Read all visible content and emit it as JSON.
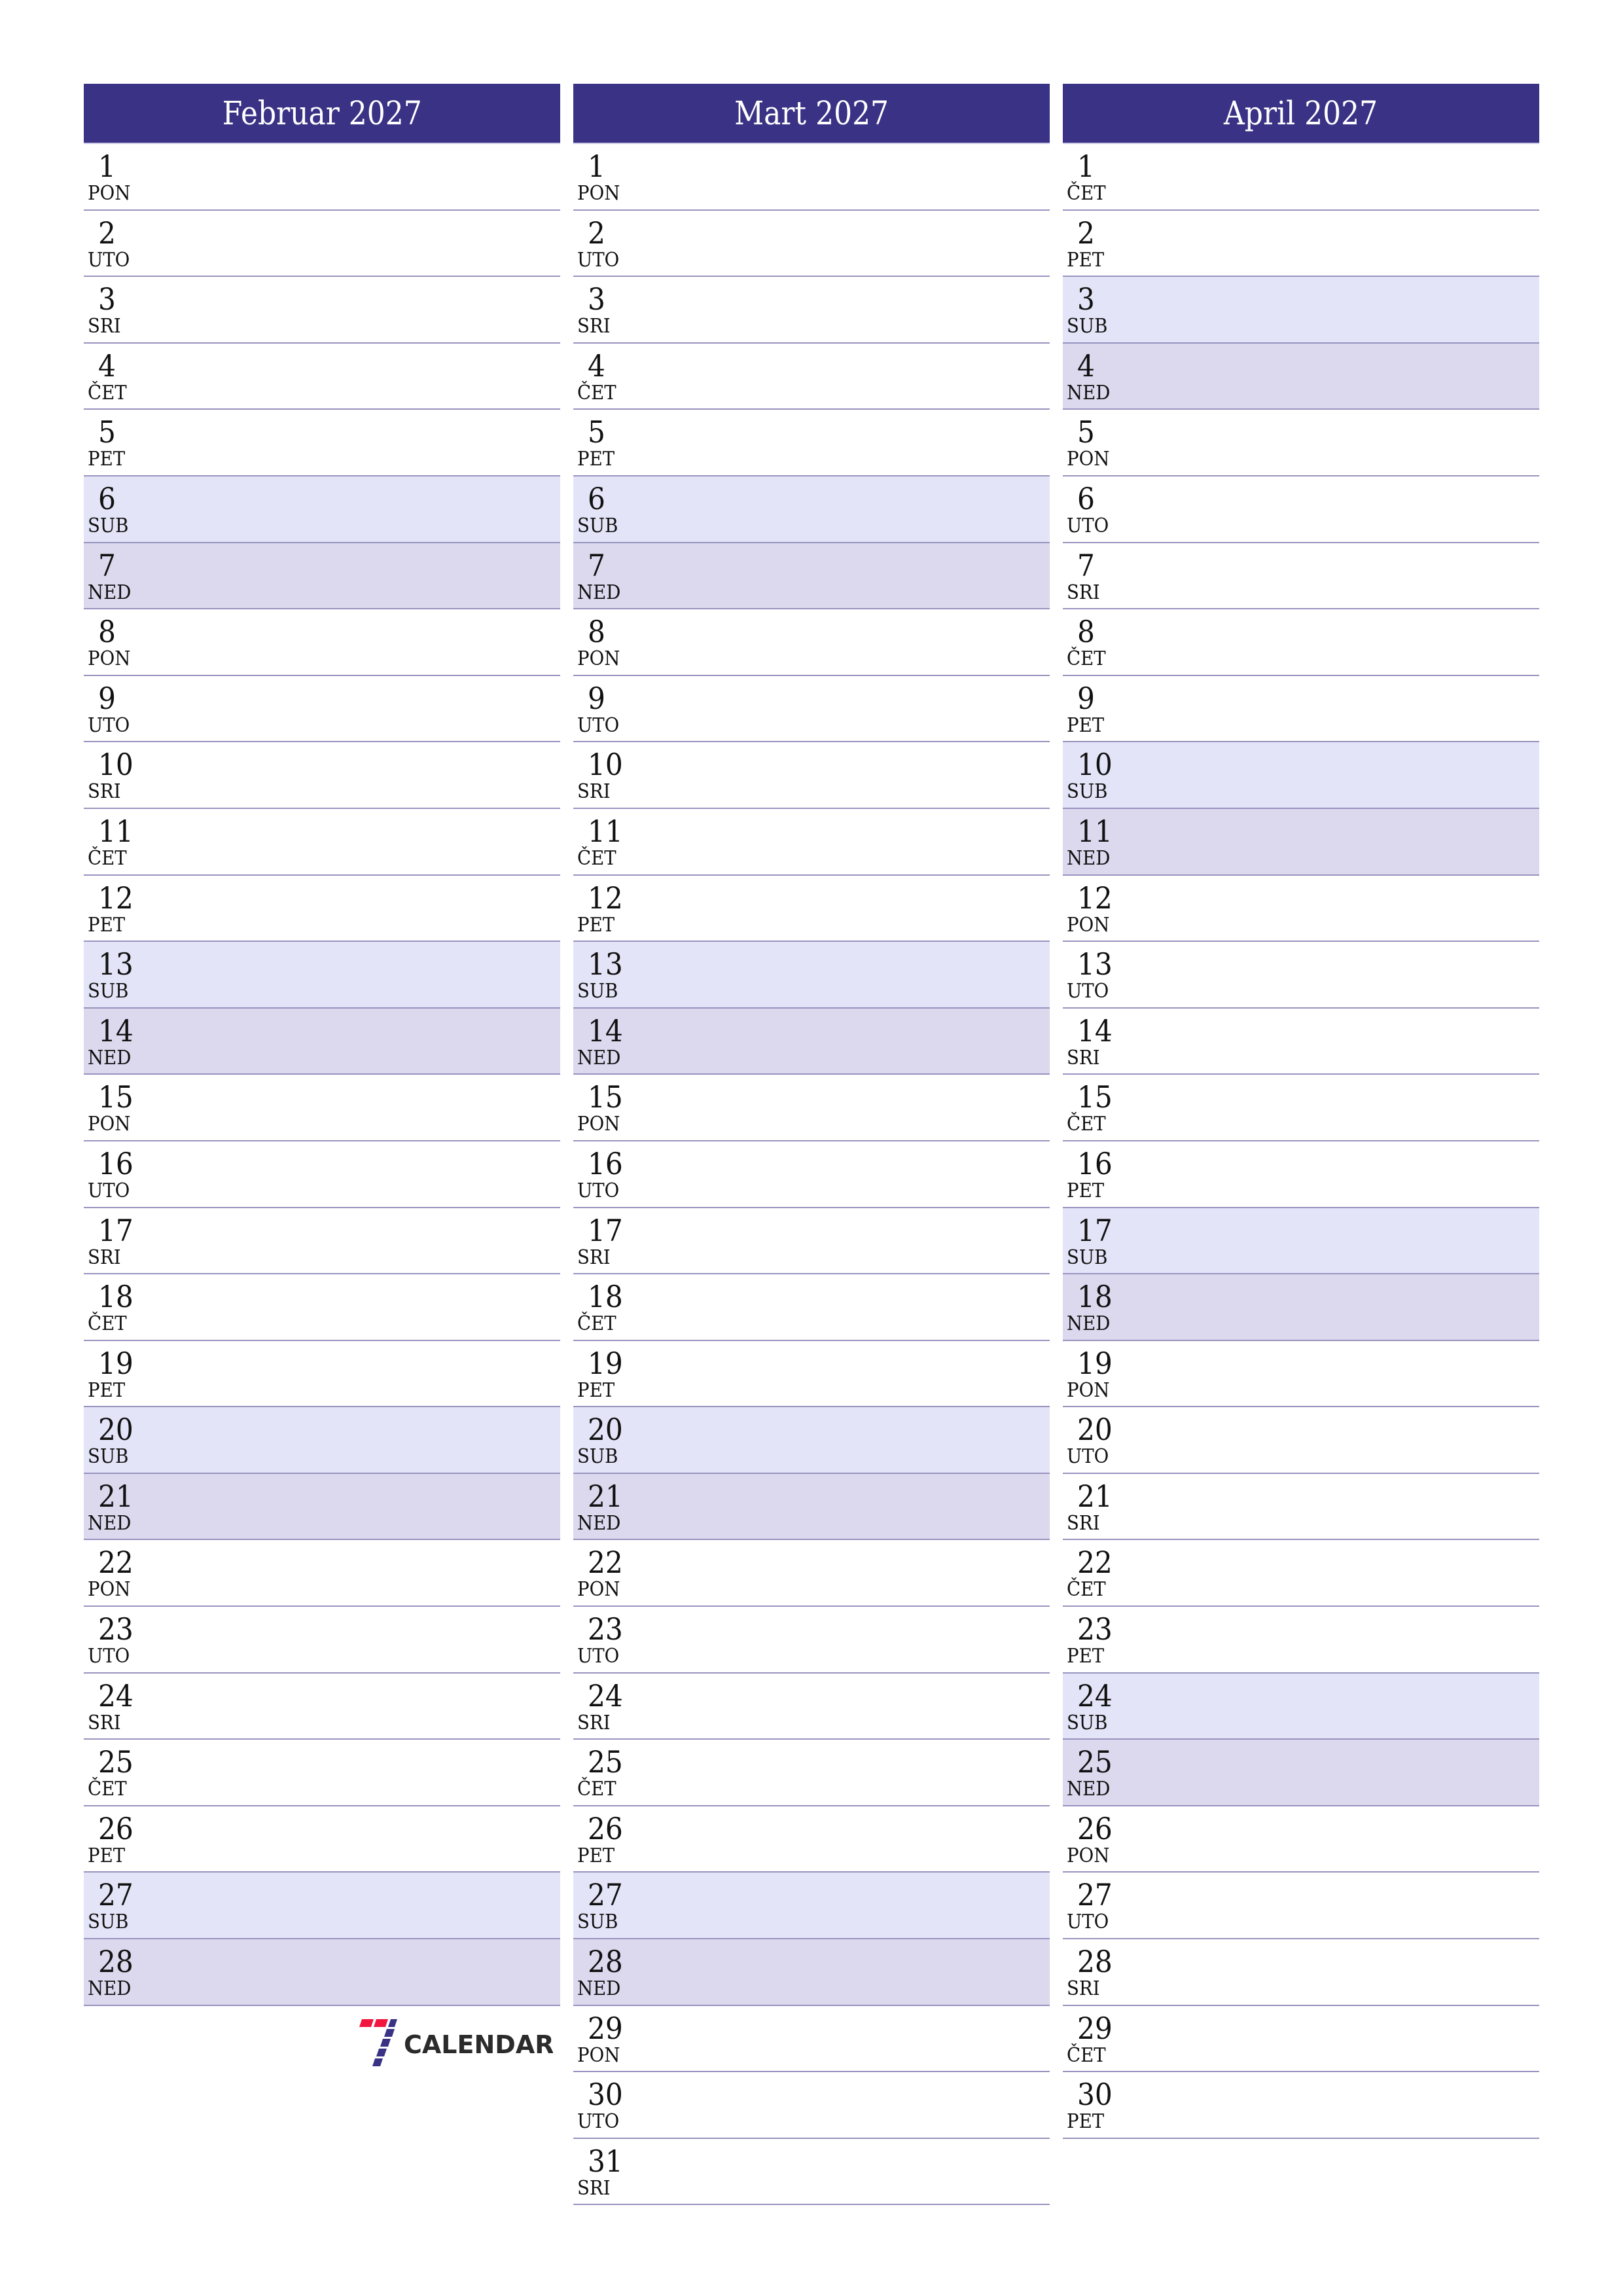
{
  "colors": {
    "header": "#3a3285",
    "saturday": "#e4e4f8",
    "sunday": "#dcd8ee",
    "divider": "#9793bf",
    "logo_red": "#f0163f",
    "logo_blue": "#3a3285",
    "logo_text": "#2b2b2b"
  },
  "logo": {
    "text": "CALENDAR"
  },
  "months": [
    {
      "title": "Februar 2027",
      "days": [
        {
          "n": "1",
          "wd": "PON"
        },
        {
          "n": "2",
          "wd": "UTO"
        },
        {
          "n": "3",
          "wd": "SRI"
        },
        {
          "n": "4",
          "wd": "ČET"
        },
        {
          "n": "5",
          "wd": "PET"
        },
        {
          "n": "6",
          "wd": "SUB"
        },
        {
          "n": "7",
          "wd": "NED"
        },
        {
          "n": "8",
          "wd": "PON"
        },
        {
          "n": "9",
          "wd": "UTO"
        },
        {
          "n": "10",
          "wd": "SRI"
        },
        {
          "n": "11",
          "wd": "ČET"
        },
        {
          "n": "12",
          "wd": "PET"
        },
        {
          "n": "13",
          "wd": "SUB"
        },
        {
          "n": "14",
          "wd": "NED"
        },
        {
          "n": "15",
          "wd": "PON"
        },
        {
          "n": "16",
          "wd": "UTO"
        },
        {
          "n": "17",
          "wd": "SRI"
        },
        {
          "n": "18",
          "wd": "ČET"
        },
        {
          "n": "19",
          "wd": "PET"
        },
        {
          "n": "20",
          "wd": "SUB"
        },
        {
          "n": "21",
          "wd": "NED"
        },
        {
          "n": "22",
          "wd": "PON"
        },
        {
          "n": "23",
          "wd": "UTO"
        },
        {
          "n": "24",
          "wd": "SRI"
        },
        {
          "n": "25",
          "wd": "ČET"
        },
        {
          "n": "26",
          "wd": "PET"
        },
        {
          "n": "27",
          "wd": "SUB"
        },
        {
          "n": "28",
          "wd": "NED"
        }
      ]
    },
    {
      "title": "Mart 2027",
      "days": [
        {
          "n": "1",
          "wd": "PON"
        },
        {
          "n": "2",
          "wd": "UTO"
        },
        {
          "n": "3",
          "wd": "SRI"
        },
        {
          "n": "4",
          "wd": "ČET"
        },
        {
          "n": "5",
          "wd": "PET"
        },
        {
          "n": "6",
          "wd": "SUB"
        },
        {
          "n": "7",
          "wd": "NED"
        },
        {
          "n": "8",
          "wd": "PON"
        },
        {
          "n": "9",
          "wd": "UTO"
        },
        {
          "n": "10",
          "wd": "SRI"
        },
        {
          "n": "11",
          "wd": "ČET"
        },
        {
          "n": "12",
          "wd": "PET"
        },
        {
          "n": "13",
          "wd": "SUB"
        },
        {
          "n": "14",
          "wd": "NED"
        },
        {
          "n": "15",
          "wd": "PON"
        },
        {
          "n": "16",
          "wd": "UTO"
        },
        {
          "n": "17",
          "wd": "SRI"
        },
        {
          "n": "18",
          "wd": "ČET"
        },
        {
          "n": "19",
          "wd": "PET"
        },
        {
          "n": "20",
          "wd": "SUB"
        },
        {
          "n": "21",
          "wd": "NED"
        },
        {
          "n": "22",
          "wd": "PON"
        },
        {
          "n": "23",
          "wd": "UTO"
        },
        {
          "n": "24",
          "wd": "SRI"
        },
        {
          "n": "25",
          "wd": "ČET"
        },
        {
          "n": "26",
          "wd": "PET"
        },
        {
          "n": "27",
          "wd": "SUB"
        },
        {
          "n": "28",
          "wd": "NED"
        },
        {
          "n": "29",
          "wd": "PON"
        },
        {
          "n": "30",
          "wd": "UTO"
        },
        {
          "n": "31",
          "wd": "SRI"
        }
      ]
    },
    {
      "title": "April 2027",
      "days": [
        {
          "n": "1",
          "wd": "ČET"
        },
        {
          "n": "2",
          "wd": "PET"
        },
        {
          "n": "3",
          "wd": "SUB"
        },
        {
          "n": "4",
          "wd": "NED"
        },
        {
          "n": "5",
          "wd": "PON"
        },
        {
          "n": "6",
          "wd": "UTO"
        },
        {
          "n": "7",
          "wd": "SRI"
        },
        {
          "n": "8",
          "wd": "ČET"
        },
        {
          "n": "9",
          "wd": "PET"
        },
        {
          "n": "10",
          "wd": "SUB"
        },
        {
          "n": "11",
          "wd": "NED"
        },
        {
          "n": "12",
          "wd": "PON"
        },
        {
          "n": "13",
          "wd": "UTO"
        },
        {
          "n": "14",
          "wd": "SRI"
        },
        {
          "n": "15",
          "wd": "ČET"
        },
        {
          "n": "16",
          "wd": "PET"
        },
        {
          "n": "17",
          "wd": "SUB"
        },
        {
          "n": "18",
          "wd": "NED"
        },
        {
          "n": "19",
          "wd": "PON"
        },
        {
          "n": "20",
          "wd": "UTO"
        },
        {
          "n": "21",
          "wd": "SRI"
        },
        {
          "n": "22",
          "wd": "ČET"
        },
        {
          "n": "23",
          "wd": "PET"
        },
        {
          "n": "24",
          "wd": "SUB"
        },
        {
          "n": "25",
          "wd": "NED"
        },
        {
          "n": "26",
          "wd": "PON"
        },
        {
          "n": "27",
          "wd": "UTO"
        },
        {
          "n": "28",
          "wd": "SRI"
        },
        {
          "n": "29",
          "wd": "ČET"
        },
        {
          "n": "30",
          "wd": "PET"
        }
      ]
    }
  ]
}
